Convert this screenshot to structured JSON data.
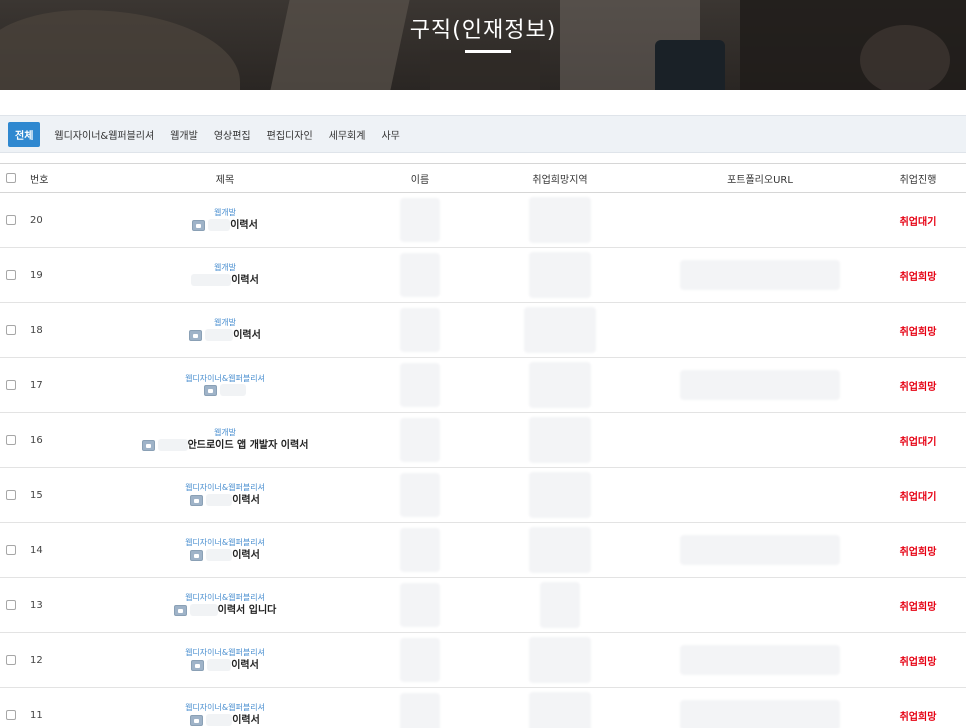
{
  "header": {
    "title": "구직(인재정보)"
  },
  "categories": [
    "전체",
    "웹디자이너&웹퍼블리셔",
    "웹개발",
    "영상편집",
    "편집디자인",
    "세무회계",
    "사무"
  ],
  "table": {
    "headers": {
      "num": "번호",
      "title": "제목",
      "name": "이름",
      "area": "취업희망지역",
      "url": "포트폴리오URL",
      "status": "취업진행"
    },
    "rows": [
      {
        "num": "20",
        "category": "웹개발",
        "title": "이력서",
        "status": "취업대기"
      },
      {
        "num": "19",
        "category": "웹개발",
        "title": "이력서",
        "status": "취업희망"
      },
      {
        "num": "18",
        "category": "웹개발",
        "title": "이력서",
        "status": "취업희망"
      },
      {
        "num": "17",
        "category": "웹디자이너&웹퍼블리셔",
        "title": "",
        "status": "취업희망"
      },
      {
        "num": "16",
        "category": "웹개발",
        "title": "안드로이드 앱 개발자 이력서",
        "status": "취업대기"
      },
      {
        "num": "15",
        "category": "웹디자이너&웹퍼블리셔",
        "title": "이력서",
        "status": "취업대기"
      },
      {
        "num": "14",
        "category": "웹디자이너&웹퍼블리셔",
        "title": "이력서",
        "status": "취업희망"
      },
      {
        "num": "13",
        "category": "웹디자이너&웹퍼블리셔",
        "title": "이력서 입니다",
        "status": "취업희망"
      },
      {
        "num": "12",
        "category": "웹디자이너&웹퍼블리셔",
        "title": "이력서",
        "status": "취업희망"
      },
      {
        "num": "11",
        "category": "웹디자이너&웹퍼블리셔",
        "title": "이력서",
        "status": "취업희망"
      }
    ]
  },
  "colors": {
    "accent": "#2f88d0",
    "status_red": "#e60012",
    "category_link": "#4a8fd0",
    "catbar_bg": "#eef2f6"
  },
  "icons": {
    "lock": "lock-icon",
    "checkbox": "checkbox"
  }
}
